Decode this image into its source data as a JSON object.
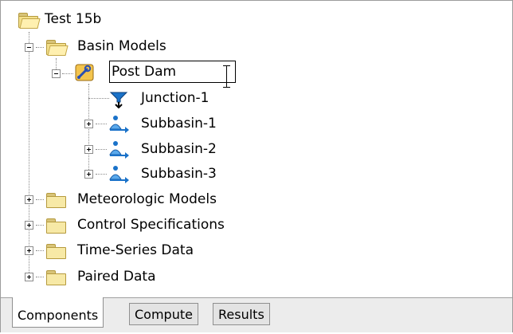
{
  "tree": {
    "root": {
      "label": "Test 15b"
    },
    "basin_models": {
      "label": "Basin Models",
      "model": {
        "label": "Post Dam",
        "children": [
          {
            "label": "Junction-1",
            "icon": "junction-icon"
          },
          {
            "label": "Subbasin-1",
            "icon": "subbasin-icon"
          },
          {
            "label": "Subbasin-2",
            "icon": "subbasin-icon"
          },
          {
            "label": "Subbasin-3",
            "icon": "subbasin-icon"
          }
        ]
      }
    },
    "folders": [
      {
        "label": "Meteorologic Models"
      },
      {
        "label": "Control Specifications"
      },
      {
        "label": "Time-Series Data"
      },
      {
        "label": "Paired Data"
      }
    ]
  },
  "tabs": [
    {
      "label": "Components",
      "active": true
    },
    {
      "label": "Compute",
      "active": false
    },
    {
      "label": "Results",
      "active": false
    }
  ],
  "colors": {
    "folder_fill": "#f7e9a6",
    "folder_border": "#b59a3e",
    "element_blue": "#1a72c9",
    "tab_strip": "#ececec"
  }
}
